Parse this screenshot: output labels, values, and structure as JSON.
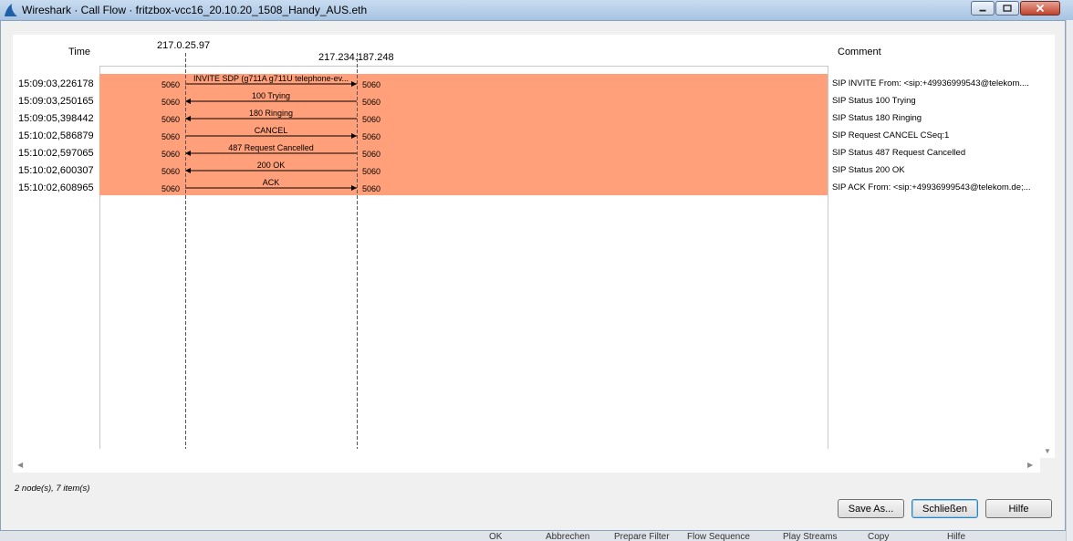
{
  "window": {
    "title": "Wireshark · Call Flow · fritzbox-vcc16_20.10.20_1508_Handy_AUS.eth"
  },
  "headers": {
    "time": "Time",
    "comment": "Comment"
  },
  "nodes": [
    "217.0.25.97",
    "217.234.187.248"
  ],
  "flows": [
    {
      "time": "15:09:03,226178",
      "label": "INVITE SDP (g711A g711U telephone-ev...",
      "src_port": "5060",
      "dst_port": "5060",
      "direction": "right",
      "comment": "SIP INVITE From: <sip:+49936999543@telekom...."
    },
    {
      "time": "15:09:03,250165",
      "label": "100 Trying",
      "src_port": "5060",
      "dst_port": "5060",
      "direction": "left",
      "comment": "SIP Status 100 Trying"
    },
    {
      "time": "15:09:05,398442",
      "label": "180 Ringing",
      "src_port": "5060",
      "dst_port": "5060",
      "direction": "left",
      "comment": "SIP Status 180 Ringing"
    },
    {
      "time": "15:10:02,586879",
      "label": "CANCEL",
      "src_port": "5060",
      "dst_port": "5060",
      "direction": "right",
      "comment": "SIP Request CANCEL CSeq:1"
    },
    {
      "time": "15:10:02,597065",
      "label": "487 Request Cancelled",
      "src_port": "5060",
      "dst_port": "5060",
      "direction": "left",
      "comment": "SIP Status 487 Request Cancelled"
    },
    {
      "time": "15:10:02,600307",
      "label": "200 OK",
      "src_port": "5060",
      "dst_port": "5060",
      "direction": "left",
      "comment": "SIP Status 200 OK"
    },
    {
      "time": "15:10:02,608965",
      "label": "ACK",
      "src_port": "5060",
      "dst_port": "5060",
      "direction": "right",
      "comment": "SIP ACK From: <sip:+49936999543@telekom.de;..."
    }
  ],
  "status": "2 node(s), 7 item(s)",
  "buttons": {
    "save_as": "Save As...",
    "close": "Schließen",
    "help": "Hilfe"
  },
  "background_toolbar": [
    "OK",
    "Abbrechen",
    "Prepare Filter",
    "Flow Sequence",
    "Play Streams",
    "Copy",
    "Hilfe"
  ],
  "colors": {
    "flow_highlight": "#ffa07a",
    "titlebar": "#b9d1ea"
  }
}
